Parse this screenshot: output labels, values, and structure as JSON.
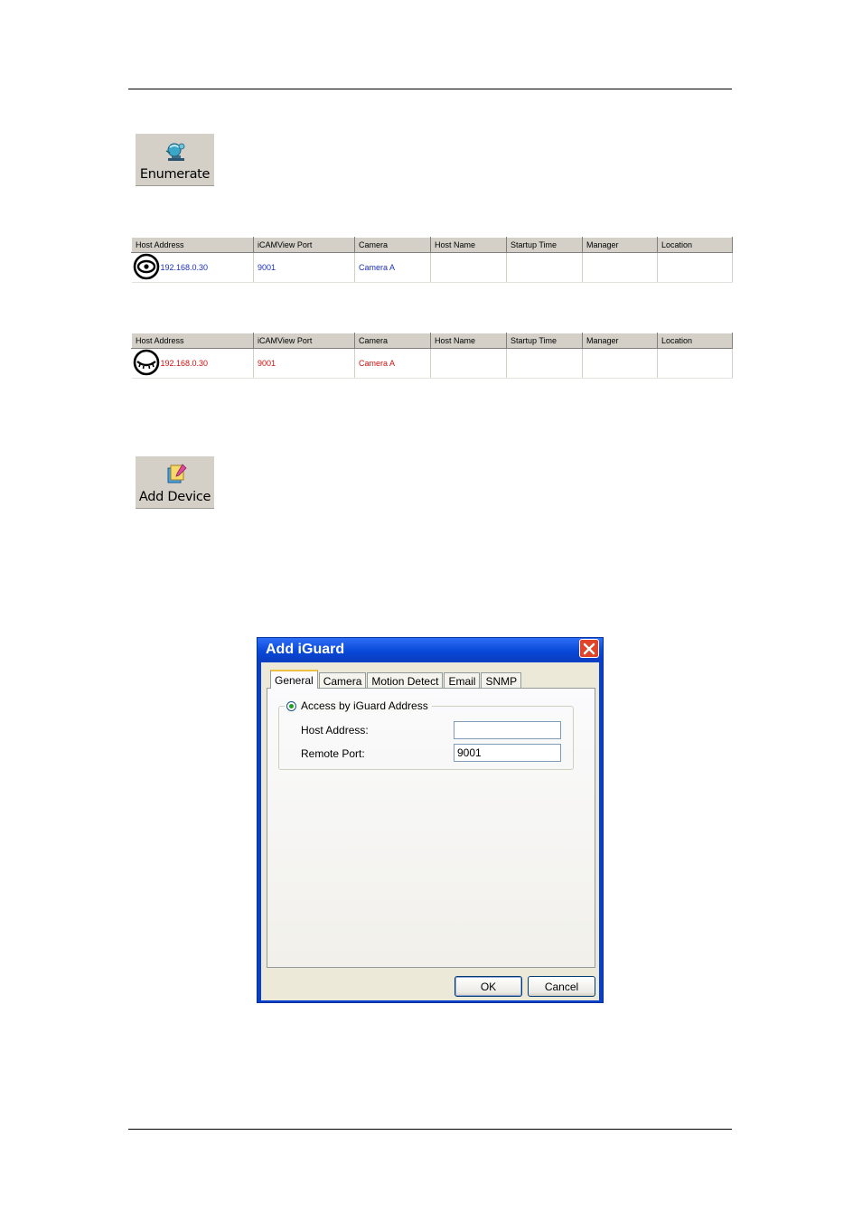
{
  "toolbar_buttons": {
    "enumerate_label": "Enumerate",
    "add_device_label": "Add Device"
  },
  "device_table": {
    "columns": [
      "Host Address",
      "iCAMView Port",
      "Camera",
      "Host Name",
      "Startup Time",
      "Manager",
      "Location"
    ],
    "online_row": {
      "host": "192.168.0.30",
      "port": "9001",
      "camera": "Camera A",
      "host_name": "",
      "startup_time": "",
      "manager": "",
      "location": ""
    },
    "offline_row": {
      "host": "192.168.0.30",
      "port": "9001",
      "camera": "Camera A",
      "host_name": "",
      "startup_time": "",
      "manager": "",
      "location": ""
    },
    "online_color": "#1a2fbf",
    "offline_color": "#d01010"
  },
  "dialog": {
    "title": "Add iGuard",
    "tabs": [
      "General",
      "Camera",
      "Motion Detect",
      "Email",
      "SNMP"
    ],
    "active_tab": "General",
    "group_label": "Access by iGuard Address",
    "host_address_label": "Host Address:",
    "host_address_value": "",
    "remote_port_label": "Remote Port:",
    "remote_port_value": "9001",
    "ok_label": "OK",
    "cancel_label": "Cancel"
  }
}
